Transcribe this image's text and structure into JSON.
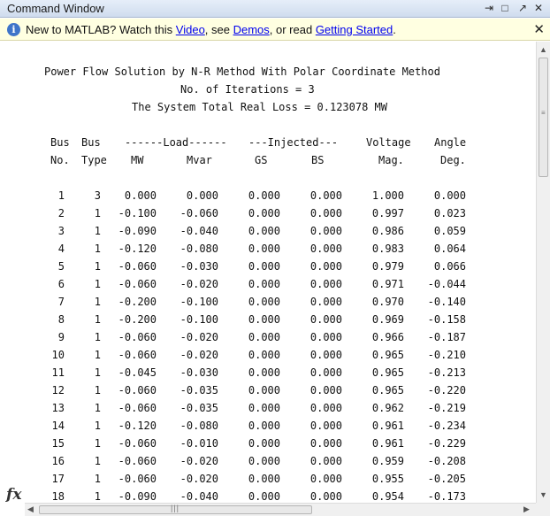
{
  "window": {
    "title": "Command Window",
    "buttons": {
      "undock": "⇥",
      "maximize": "□",
      "minimize": "↗",
      "close": "✕"
    }
  },
  "infobar": {
    "icon": "info-icon",
    "prefix": "New to MATLAB? Watch this ",
    "link_video": "Video",
    "sep1": ", see ",
    "link_demos": "Demos",
    "sep2": ", or read ",
    "link_getting_started": "Getting Started",
    "suffix": ".",
    "close": "✕"
  },
  "output": {
    "header_line1": "Power Flow Solution by N-R Method With Polar Coordinate Method",
    "header_line2": "No. of Iterations = 3",
    "header_line3": "The System Total Real Loss = 0.123078 MW",
    "col_header1": [
      "Bus",
      "Bus",
      "------Load------",
      "---Injected---",
      "Voltage",
      "Angle"
    ],
    "col_header2": [
      "No.",
      "Type",
      "MW",
      "Mvar",
      "GS",
      "BS",
      "Mag.",
      "Deg."
    ],
    "rows": [
      [
        "1",
        "3",
        "0.000",
        "0.000",
        "0.000",
        "0.000",
        "1.000",
        "0.000"
      ],
      [
        "2",
        "1",
        "-0.100",
        "-0.060",
        "0.000",
        "0.000",
        "0.997",
        "0.023"
      ],
      [
        "3",
        "1",
        "-0.090",
        "-0.040",
        "0.000",
        "0.000",
        "0.986",
        "0.059"
      ],
      [
        "4",
        "1",
        "-0.120",
        "-0.080",
        "0.000",
        "0.000",
        "0.983",
        "0.064"
      ],
      [
        "5",
        "1",
        "-0.060",
        "-0.030",
        "0.000",
        "0.000",
        "0.979",
        "0.066"
      ],
      [
        "6",
        "1",
        "-0.060",
        "-0.020",
        "0.000",
        "0.000",
        "0.971",
        "-0.044"
      ],
      [
        "7",
        "1",
        "-0.200",
        "-0.100",
        "0.000",
        "0.000",
        "0.970",
        "-0.140"
      ],
      [
        "8",
        "1",
        "-0.200",
        "-0.100",
        "0.000",
        "0.000",
        "0.969",
        "-0.158"
      ],
      [
        "9",
        "1",
        "-0.060",
        "-0.020",
        "0.000",
        "0.000",
        "0.966",
        "-0.187"
      ],
      [
        "10",
        "1",
        "-0.060",
        "-0.020",
        "0.000",
        "0.000",
        "0.965",
        "-0.210"
      ],
      [
        "11",
        "1",
        "-0.045",
        "-0.030",
        "0.000",
        "0.000",
        "0.965",
        "-0.213"
      ],
      [
        "12",
        "1",
        "-0.060",
        "-0.035",
        "0.000",
        "0.000",
        "0.965",
        "-0.220"
      ],
      [
        "13",
        "1",
        "-0.060",
        "-0.035",
        "0.000",
        "0.000",
        "0.962",
        "-0.219"
      ],
      [
        "14",
        "1",
        "-0.120",
        "-0.080",
        "0.000",
        "0.000",
        "0.961",
        "-0.234"
      ],
      [
        "15",
        "1",
        "-0.060",
        "-0.010",
        "0.000",
        "0.000",
        "0.961",
        "-0.229"
      ],
      [
        "16",
        "1",
        "-0.060",
        "-0.020",
        "0.000",
        "0.000",
        "0.959",
        "-0.208"
      ],
      [
        "17",
        "1",
        "-0.060",
        "-0.020",
        "0.000",
        "0.000",
        "0.955",
        "-0.205"
      ],
      [
        "18",
        "1",
        "-0.090",
        "-0.040",
        "0.000",
        "0.000",
        "0.954",
        "-0.173"
      ]
    ]
  },
  "prompt": {
    "icon": "fx-icon",
    "label": "fx"
  },
  "scrollbars": {
    "up": "▲",
    "down": "▼",
    "left": "◀",
    "right": "▶",
    "grip_v": "≡",
    "grip_h": "|||"
  }
}
